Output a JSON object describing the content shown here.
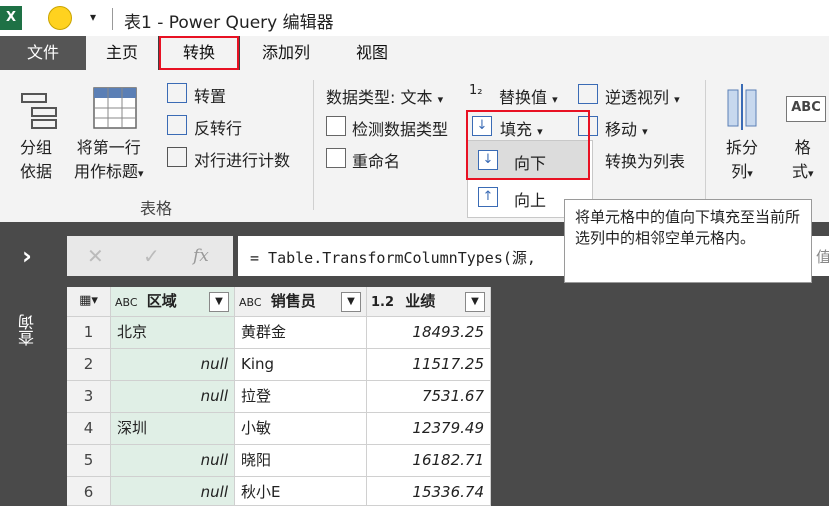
{
  "titlebar": {
    "title": "表1 - Power Query 编辑器",
    "excel_icon": "X"
  },
  "tabs": [
    {
      "label": "文件"
    },
    {
      "label": "主页"
    },
    {
      "label": "转换"
    },
    {
      "label": "添加列"
    },
    {
      "label": "视图"
    }
  ],
  "ribbon": {
    "group_by": {
      "line1": "分组",
      "line2": "依据"
    },
    "first_row_header": {
      "line1": "将第一行",
      "line2": "用作标题",
      "arrow": "▾"
    },
    "transpose": "转置",
    "reverse_rows": "反转行",
    "count_rows": "对行进行计数",
    "table_group_label": "表格",
    "data_type": "数据类型: 文本",
    "detect_type": "检测数据类型",
    "rename": "重命名",
    "replace_values": "替换值",
    "fill": "填充",
    "unpivot": "逆透视列",
    "move": "移动",
    "to_list": "转换为列表",
    "split_column": {
      "line1": "拆分",
      "line2": "列"
    },
    "format": {
      "line1": "格",
      "line2": "式"
    },
    "dropdown_arrow": "▾",
    "abc_icon": "ABC",
    "r12_icon": "1₂"
  },
  "fill_menu": {
    "down": "向下",
    "up": "向上"
  },
  "tooltip": {
    "text": "将单元格中的值向下填充至当前所选列中的相邻空单元格内。"
  },
  "sidebar": {
    "chevron": "›",
    "label": "查询"
  },
  "formula": {
    "cancel": "✕",
    "confirm": "✓",
    "fx": "fx",
    "text": "= Table.TransformColumnTypes(源,",
    "trail": "值"
  },
  "table": {
    "columns": [
      {
        "type": "ABC",
        "name": "区域"
      },
      {
        "type": "ABC",
        "name": "销售员"
      },
      {
        "type": "1.2",
        "name": "业绩"
      }
    ],
    "rows": [
      {
        "num": "1",
        "region": "北京",
        "salesperson": "黄群金",
        "value": "18493.25"
      },
      {
        "num": "2",
        "region": "null",
        "salesperson": "King",
        "value": "11517.25"
      },
      {
        "num": "3",
        "region": "null",
        "salesperson": "拉登",
        "value": "7531.67"
      },
      {
        "num": "4",
        "region": "深圳",
        "salesperson": "小敏",
        "value": "12379.49"
      },
      {
        "num": "5",
        "region": "null",
        "salesperson": "晓阳",
        "value": "16182.71"
      },
      {
        "num": "6",
        "region": "null",
        "salesperson": "秋小E",
        "value": "15336.74"
      }
    ]
  },
  "colors": {
    "accent_red": "#e81123",
    "selected_column": "#e0efe6",
    "dark_bg": "#4a4a4a",
    "excel_green": "#1e7145"
  }
}
